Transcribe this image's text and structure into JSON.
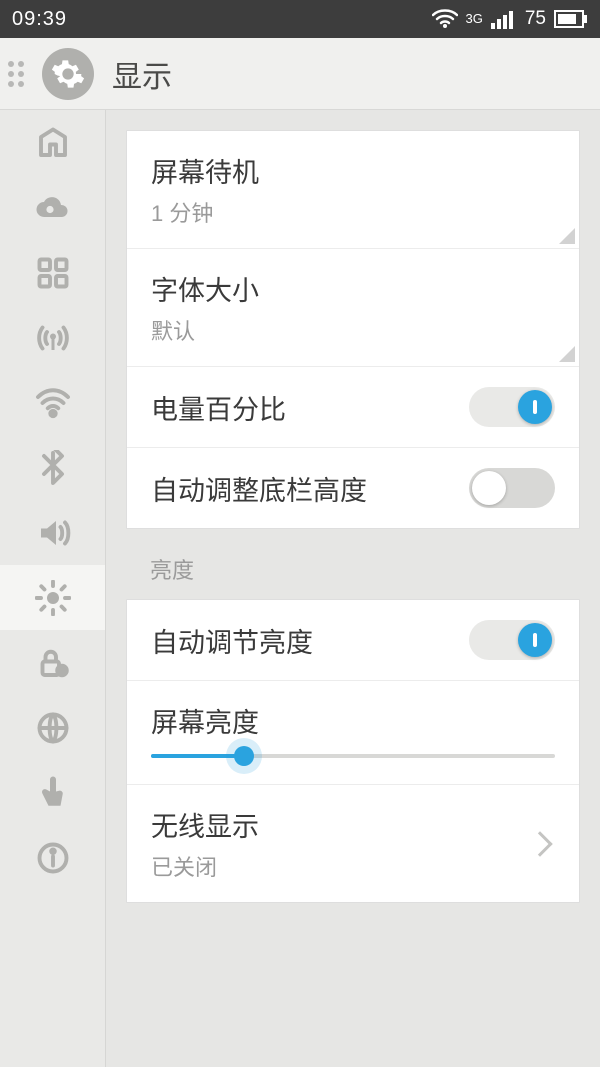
{
  "status": {
    "time": "09:39",
    "network_label": "3G",
    "battery": "75"
  },
  "header": {
    "title": "显示"
  },
  "sidebar": {
    "items": [
      {
        "name": "home"
      },
      {
        "name": "cloud"
      },
      {
        "name": "apps"
      },
      {
        "name": "cellular"
      },
      {
        "name": "wifi"
      },
      {
        "name": "bluetooth"
      },
      {
        "name": "sound"
      },
      {
        "name": "display"
      },
      {
        "name": "security"
      },
      {
        "name": "globe"
      },
      {
        "name": "touch"
      },
      {
        "name": "info"
      }
    ],
    "active_index": 7
  },
  "rows": {
    "screen_timeout": {
      "title": "屏幕待机",
      "value": "1 分钟"
    },
    "font_size": {
      "title": "字体大小",
      "value": "默认"
    },
    "battery_percent": {
      "title": "电量百分比",
      "on": true
    },
    "auto_navbar_height": {
      "title": "自动调整底栏高度",
      "on": false
    },
    "section_brightness": "亮度",
    "auto_brightness": {
      "title": "自动调节亮度",
      "on": true
    },
    "screen_brightness": {
      "title": "屏幕亮度",
      "percent": 23
    },
    "wireless_display": {
      "title": "无线显示",
      "value": "已关闭"
    }
  }
}
